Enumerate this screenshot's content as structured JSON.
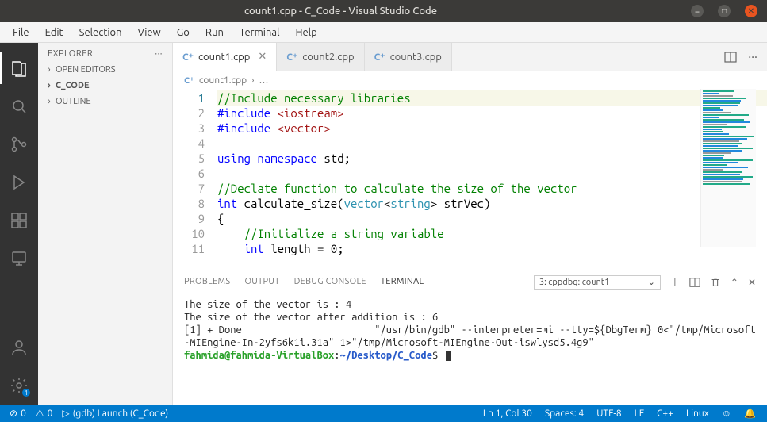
{
  "window": {
    "title": "count1.cpp - C_Code - Visual Studio Code"
  },
  "menubar": [
    "File",
    "Edit",
    "Selection",
    "View",
    "Go",
    "Run",
    "Terminal",
    "Help"
  ],
  "sidebar": {
    "title": "EXPLORER",
    "sections": [
      {
        "label": "OPEN EDITORS",
        "bold": false
      },
      {
        "label": "C_CODE",
        "bold": true
      },
      {
        "label": "OUTLINE",
        "bold": false
      }
    ]
  },
  "tabs": [
    {
      "label": "count1.cpp",
      "active": true,
      "close": true
    },
    {
      "label": "count2.cpp",
      "active": false,
      "close": false
    },
    {
      "label": "count3.cpp",
      "active": false,
      "close": false
    }
  ],
  "breadcrumb": {
    "file": "count1.cpp",
    "rest": "…"
  },
  "code_lines": [
    {
      "n": 1,
      "html": "<span class=\"c-comment\">//Include necessary libraries</span>",
      "hl": true
    },
    {
      "n": 2,
      "html": "<span class=\"c-keyword\">#include</span> <span class=\"c-include\">&lt;iostream&gt;</span>"
    },
    {
      "n": 3,
      "html": "<span class=\"c-keyword\">#include</span> <span class=\"c-include\">&lt;vector&gt;</span>"
    },
    {
      "n": 4,
      "html": ""
    },
    {
      "n": 5,
      "html": "<span class=\"c-keyword\">using</span> <span class=\"c-keyword\">namespace</span> std;"
    },
    {
      "n": 6,
      "html": ""
    },
    {
      "n": 7,
      "html": "<span class=\"c-comment\">//Declate function to calculate the size of the vector</span>"
    },
    {
      "n": 8,
      "html": "<span class=\"c-keyword\">int</span> calculate_size(<span class=\"c-type\">vector</span>&lt;<span class=\"c-type\">string</span>&gt; strVec)"
    },
    {
      "n": 9,
      "html": "{"
    },
    {
      "n": 10,
      "html": "    <span class=\"c-comment\">//Initialize a string variable</span>"
    },
    {
      "n": 11,
      "html": "    <span class=\"c-keyword\">int</span> length = 0;"
    }
  ],
  "panel": {
    "tabs": [
      "PROBLEMS",
      "OUTPUT",
      "DEBUG CONSOLE",
      "TERMINAL"
    ],
    "active_tab": "TERMINAL",
    "selector": "3: cppdbg: count1",
    "terminal_lines": [
      "The size of the vector is : 4",
      "The size of the vector after addition is : 6",
      "[1] + Done                       \"/usr/bin/gdb\" --interpreter=mi --tty=${DbgTerm} 0<\"/tmp/Microsoft-MIEngine-In-2yfs6k1i.31a\" 1>\"/tmp/Microsoft-MIEngine-Out-iswlysd5.4g9\""
    ],
    "prompt_user": "fahmida@fahmida-VirtualBox",
    "prompt_sep": ":",
    "prompt_path": "~/Desktop/C_Code",
    "prompt_end": "$"
  },
  "statusbar": {
    "left": [
      {
        "icon": "⊘",
        "text": "0"
      },
      {
        "icon": "⚠",
        "text": "0"
      },
      {
        "icon": "▷",
        "text": "(gdb) Launch (C_Code)"
      }
    ],
    "right": [
      "Ln 1, Col 30",
      "Spaces: 4",
      "UTF-8",
      "LF",
      "C++",
      "Linux"
    ],
    "feedback": "☺",
    "bell": "🔔"
  },
  "activity_badge": "1"
}
